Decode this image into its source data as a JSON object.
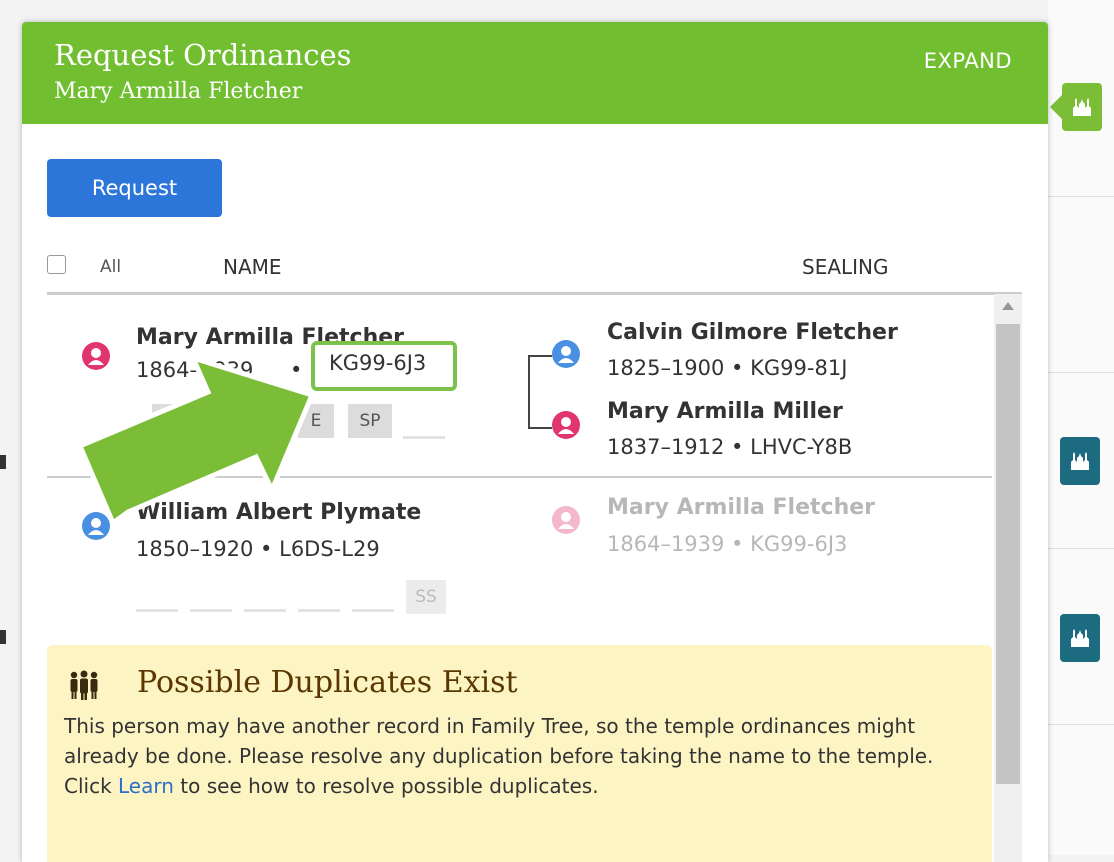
{
  "dialog": {
    "title": "Request Ordinances",
    "subtitle": "Mary Armilla Fletcher",
    "expand_label": "EXPAND",
    "request_label": "Request"
  },
  "columns": {
    "all": "All",
    "name": "NAME",
    "sealing": "SEALING"
  },
  "people": {
    "main": {
      "name": "Mary Armilla Fletcher",
      "years": "1864–1939",
      "pid": "KG99-6J3",
      "gender": "female"
    },
    "father": {
      "name": "Calvin Gilmore Fletcher",
      "info": "1825–1900 • KG99-81J",
      "gender": "male"
    },
    "mother": {
      "name": "Mary Armilla Miller",
      "info": "1837–1912 • LHVC-Y8B",
      "gender": "female"
    },
    "spouse": {
      "name": "William Albert Plymate",
      "info": "1850–1920 • L6DS-L29",
      "gender": "male"
    },
    "spouse_sealing": {
      "name": "Mary Armilla Fletcher",
      "info": "1864–1939 • KG99-6J3",
      "gender": "female"
    }
  },
  "ordinances": {
    "main": [
      "E",
      "SP"
    ],
    "spouse": [
      "SS"
    ]
  },
  "warning": {
    "title": "Possible Duplicates Exist",
    "body_1": "This person may have another record in Family Tree, so the temple ordinances might already be done. Please resolve any duplication before taking the name to the temple. Click ",
    "link": "Learn",
    "body_2": " to see how to resolve possible duplicates."
  },
  "colors": {
    "header_green": "#71bf31",
    "button_blue": "#2d76d9",
    "highlight_green": "#7bc14a",
    "male_blue": "#4a90e2",
    "female_pink": "#e0356f",
    "warning_bg": "#fdf4c4",
    "temple_teal": "#1d6b80"
  },
  "icons": [
    "temple-icon",
    "person-male-icon",
    "person-female-icon",
    "family-group-icon",
    "annotation-arrow"
  ]
}
